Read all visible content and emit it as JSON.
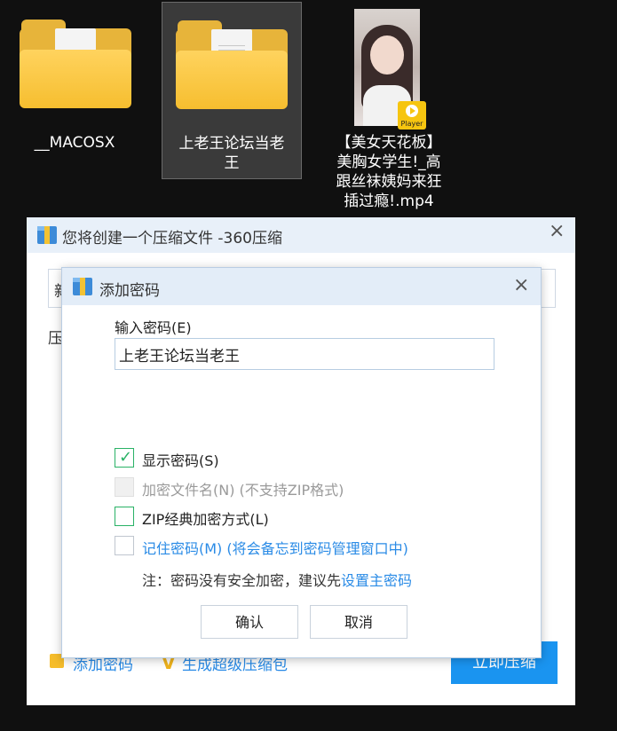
{
  "desktop": {
    "items": [
      {
        "label": "__MACOSX"
      },
      {
        "label": "上老王论坛当老王"
      },
      {
        "label_lines": [
          "【美女天花板】",
          "美胸女学生!_高",
          "跟丝袜姨妈来狂",
          "插过瘾!.mp4"
        ],
        "badge": "Player"
      }
    ]
  },
  "outer_dialog": {
    "title": "您将创建一个压缩文件 -360压缩",
    "field_prefix": "新",
    "label_prefix": "压",
    "add_password": "添加密码",
    "make_super": "生成超级压缩包",
    "compress_now": "立即压缩"
  },
  "password_dialog": {
    "title": "添加密码",
    "input_label": "输入密码(E)",
    "password_value": "上老王论坛当老王",
    "options": [
      {
        "label": "显示密码(S)",
        "checked": true,
        "enabled": true
      },
      {
        "label": "加密文件名(N) (不支持ZIP格式)",
        "checked": false,
        "enabled": false
      },
      {
        "label": "ZIP经典加密方式(L)",
        "checked": false,
        "enabled": true
      },
      {
        "label": "记住密码(M) (将会备忘到密码管理窗口中)",
        "checked": false,
        "enabled": true
      }
    ],
    "note_text": "注：密码没有安全加密，建议先",
    "note_link": "设置主密码",
    "confirm": "确认",
    "cancel": "取消"
  },
  "colors": {
    "accent_blue": "#1a94f0",
    "check_green": "#29b266",
    "folder_yellow": "#f6be2f"
  }
}
